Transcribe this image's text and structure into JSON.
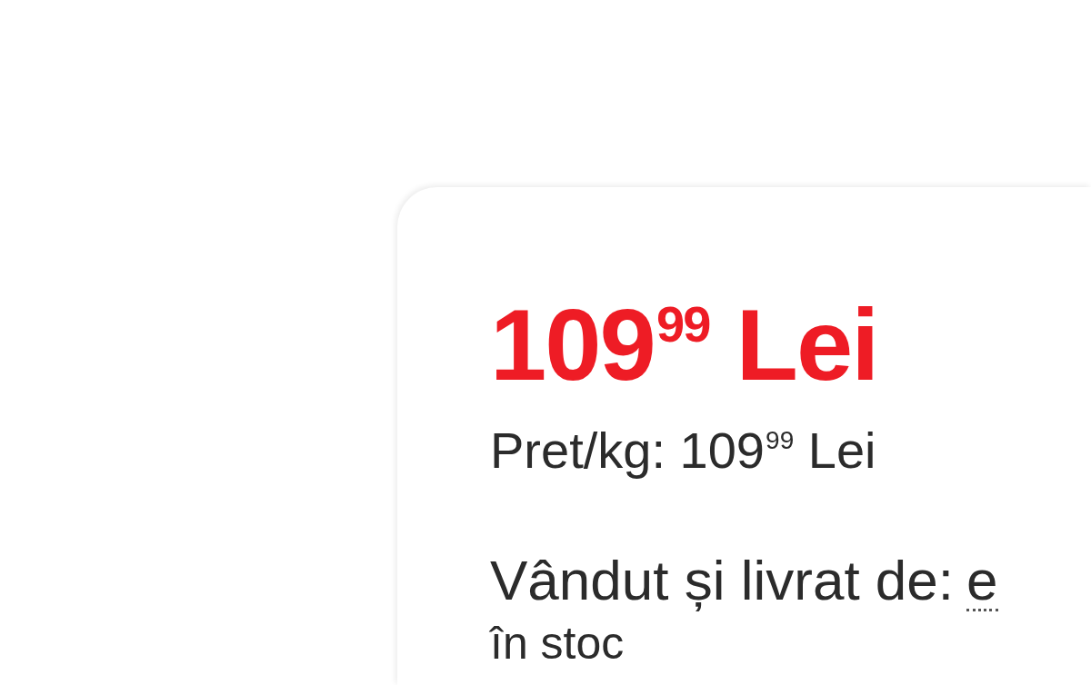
{
  "price": "109$^{99}$ Lei",
  "unit_price": "Pret/kg: 109$^{99}$ Lei",
  "seller": {
    "label": "Vândut și livrat de:",
    "name": "e"
  },
  "stock": "în stoc"
}
